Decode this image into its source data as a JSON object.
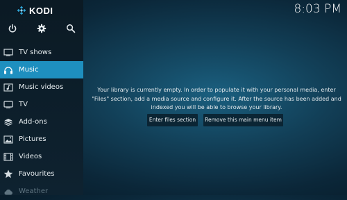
{
  "app": {
    "name": "KODI"
  },
  "clock": "8:03 PM",
  "top_icons": [
    "power-icon",
    "settings-icon",
    "search-icon"
  ],
  "nav": [
    {
      "label": "TV shows",
      "icon": "tv-icon"
    },
    {
      "label": "Music",
      "icon": "headphones-icon",
      "active": true
    },
    {
      "label": "Music videos",
      "icon": "music-video-icon"
    },
    {
      "label": "TV",
      "icon": "tv-icon"
    },
    {
      "label": "Add-ons",
      "icon": "addons-icon"
    },
    {
      "label": "Pictures",
      "icon": "pictures-icon"
    },
    {
      "label": "Videos",
      "icon": "videos-icon"
    },
    {
      "label": "Favourites",
      "icon": "star-icon"
    },
    {
      "label": "Weather",
      "icon": "weather-icon"
    }
  ],
  "main": {
    "message": "Your library is currently empty. In order to populate it with your personal media, enter \"Files\" section, add a media source and configure it. After the source has been added and indexed you will be able to browse your library.",
    "buttons": {
      "files": "Enter files section",
      "remove": "Remove this main menu item"
    }
  },
  "colors": {
    "accent": "#1e8fbf",
    "sidebar": "#0e2230",
    "background": "#123f57"
  }
}
